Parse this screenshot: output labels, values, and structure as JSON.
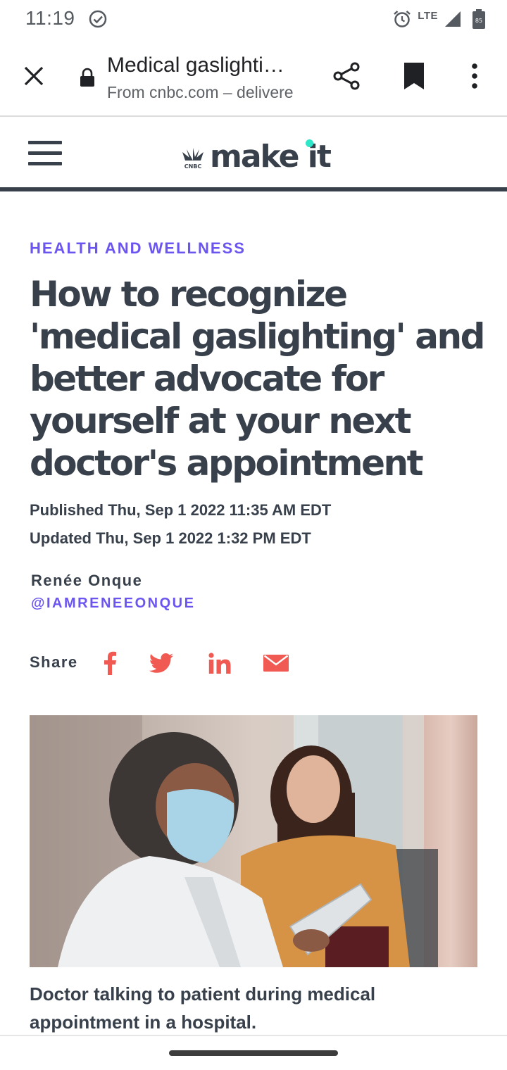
{
  "status_bar": {
    "time": "11:19",
    "network": "LTE",
    "battery": "85"
  },
  "toolbar": {
    "page_title": "Medical gaslighti…",
    "subtitle": "From cnbc.com – delivere"
  },
  "site": {
    "logo_badge": "CNBC",
    "logo_text": "make it"
  },
  "article": {
    "section": "HEALTH AND WELLNESS",
    "headline": "How to recognize 'medical gaslighting' and better advocate for yourself at your next doctor's appointment",
    "published": "Published Thu, Sep 1 2022 11:35 AM EDT",
    "updated": "Updated Thu, Sep 1 2022 1:32 PM EDT",
    "author": "Renée Onque",
    "author_handle": "@IAMRENEEONQUE",
    "share_label": "Share",
    "share_icons": [
      "facebook-icon",
      "twitter-icon",
      "linkedin-icon",
      "email-icon"
    ],
    "image_caption": "Doctor talking to patient during medical appointment in a hospital."
  },
  "colors": {
    "text": "#38404b",
    "accent_purple": "#6b55f0",
    "share_red": "#f05a52",
    "logo_dot": "#2ee6c8"
  }
}
